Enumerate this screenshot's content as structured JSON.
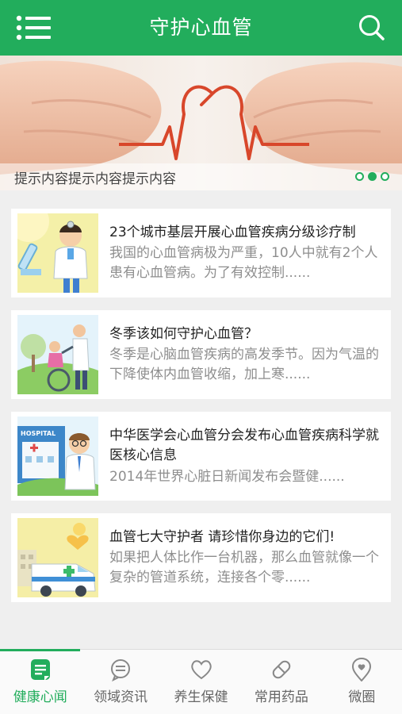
{
  "header": {
    "title": "守护心血管",
    "menu_icon": "menu-icon",
    "search_icon": "search-icon"
  },
  "banner": {
    "caption": "提示内容提示内容提示内容",
    "slide_count": 3,
    "active_slide": 2
  },
  "articles": [
    {
      "title": "23个城市基层开展心血管疾病分级诊疗制",
      "summary": "我国的心血管病极为严重，10人中就有2个人患有心血管病。为了有效控制......"
    },
    {
      "title": "冬季该如何守护心血管？",
      "summary": "冬季是心脑血管疾病的高发季节。因为气温的下降使体内血管收缩，加上寒......"
    },
    {
      "title": "中华医学会心血管分会发布心血管疾病科学就医核心信息",
      "summary": "2014年世界心脏日新闻发布会暨健......",
      "thumb_sign": "HOSPITAL"
    },
    {
      "title": "血管七大守护者 请珍惜你身边的它们!",
      "summary": "如果把人体比作一台机器，那么血管就像一个复杂的管道系统，连接各个零......"
    }
  ],
  "tabs": [
    {
      "label": "健康心闻",
      "icon": "news-doc-icon",
      "active": true
    },
    {
      "label": "领域资讯",
      "icon": "chat-bubble-icon",
      "active": false
    },
    {
      "label": "养生保健",
      "icon": "heart-icon",
      "active": false
    },
    {
      "label": "常用药品",
      "icon": "pill-icon",
      "active": false
    },
    {
      "label": "微圈",
      "icon": "heart-pin-icon",
      "active": false
    }
  ],
  "colors": {
    "brand": "#22ad5c",
    "inactive": "#666666",
    "summary": "#8e8e8e"
  }
}
